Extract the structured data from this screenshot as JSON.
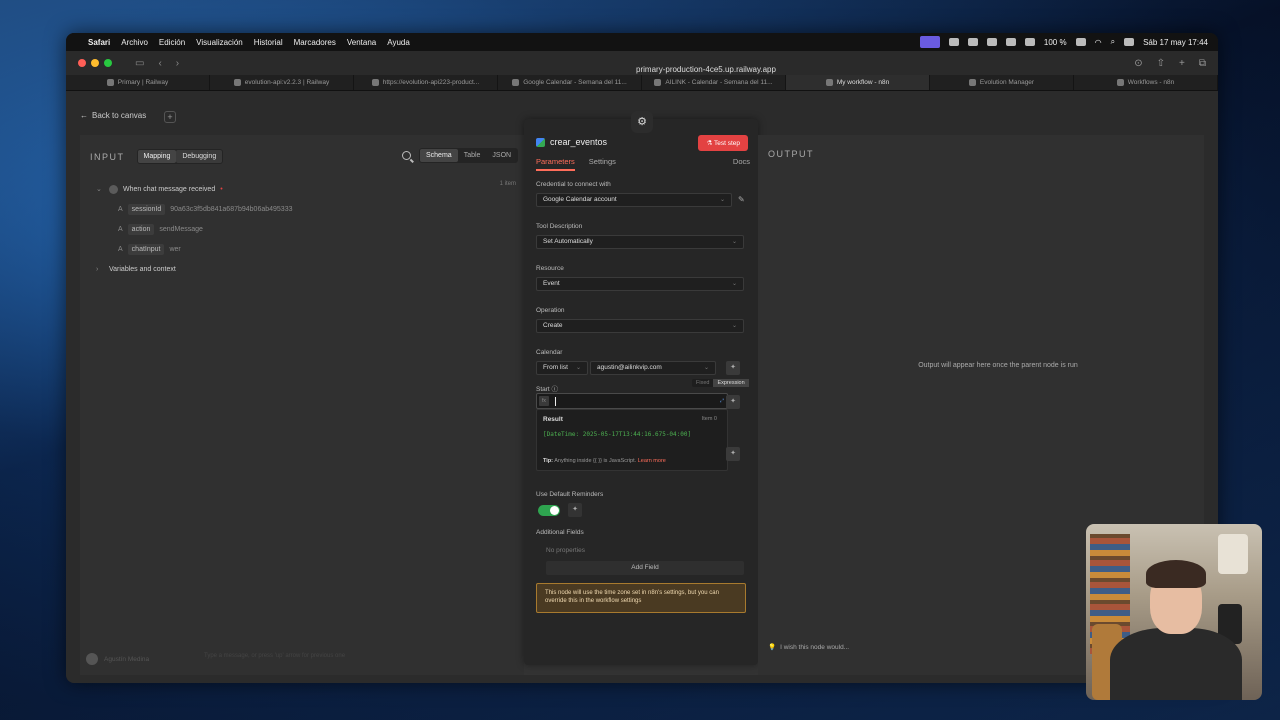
{
  "menubar": {
    "app": "Safari",
    "items": [
      "Archivo",
      "Edición",
      "Visualización",
      "Historial",
      "Marcadores",
      "Ventana",
      "Ayuda"
    ],
    "battery": "100 %",
    "clock": "Sáb 17 may 17:44"
  },
  "browser": {
    "address": "primary-production-4ce5.up.railway.app",
    "tabs": [
      {
        "label": "Primary | Railway"
      },
      {
        "label": "evolution-api:v2.2.3 | Railway"
      },
      {
        "label": "https://evolution-api223-product..."
      },
      {
        "label": "Google Calendar - Semana del 11..."
      },
      {
        "label": "AILINK - Calendar - Semana del 11..."
      },
      {
        "label": "My workflow - n8n"
      },
      {
        "label": "Evolution Manager"
      },
      {
        "label": "Workflows - n8n"
      }
    ]
  },
  "canvas": {
    "back_label": "Back to canvas"
  },
  "input": {
    "title": "INPUT",
    "mode_tabs": [
      "Mapping",
      "Debugging"
    ],
    "view_tabs": [
      "Schema",
      "Table",
      "JSON"
    ],
    "item_count": "1 item",
    "trigger": "When chat message received",
    "fields": [
      {
        "key": "sessionId",
        "value": "90a63c3f5db841a687b94b06ab495333"
      },
      {
        "key": "action",
        "value": "sendMessage"
      },
      {
        "key": "chatInput",
        "value": "wer"
      }
    ],
    "vars": "Variables and context",
    "user": "Agustín Medina",
    "chat_placeholder": "Type a message, or press 'up' arrow for previous one"
  },
  "node": {
    "name": "crear_eventos",
    "test_label": "Test step",
    "tabs": [
      "Parameters",
      "Settings"
    ],
    "docs": "Docs",
    "credential_label": "Credential to connect with",
    "credential_value": "Google Calendar account",
    "tool_desc_label": "Tool Description",
    "tool_desc_value": "Set Automatically",
    "resource_label": "Resource",
    "resource_value": "Event",
    "operation_label": "Operation",
    "operation_value": "Create",
    "calendar_label": "Calendar",
    "calendar_mode": "From list",
    "calendar_value": "agustin@ailinkvip.com",
    "start_label": "Start",
    "fixed_label": "Fixed",
    "expression_label": "Expression",
    "result_label": "Result",
    "result_item": "Item  0",
    "result_value": "[DateTime: 2025-05-17T13:44:16.675-04:00]",
    "tip_prefix": "Tip:",
    "tip_text": "Anything inside {{ }} is JavaScript.",
    "tip_link": "Learn more",
    "reminders_label": "Use Default Reminders",
    "reminders_on": true,
    "additional_label": "Additional Fields",
    "no_props": "No properties",
    "add_field": "Add Field",
    "notice": "This node will use the time zone set in n8n's settings, but you can override this in the workflow settings"
  },
  "output": {
    "title": "OUTPUT",
    "message": "Output will appear here once the parent node is run",
    "feedback": "I wish this node would..."
  },
  "colors": {
    "accent": "#ff6d5a",
    "test_button": "#e34242",
    "toggle_on": "#2ea44f",
    "result_green": "#4caf50"
  }
}
